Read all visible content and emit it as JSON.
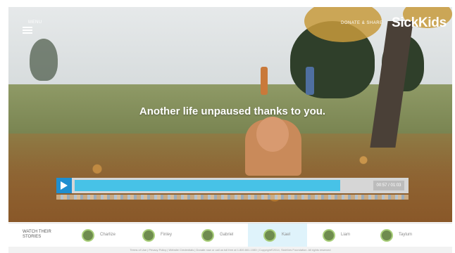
{
  "header": {
    "menu_label": "MENU",
    "donate_label": "DONATE & SHARE",
    "brand": "SickKids"
  },
  "hero": {
    "headline": "Another life unpaused thanks to you."
  },
  "player": {
    "time": "00:57 / 01:03",
    "progress": 0.82
  },
  "stories": {
    "title": "WATCH THEIR STORIES",
    "items": [
      {
        "name": "Charlize"
      },
      {
        "name": "Finley"
      },
      {
        "name": "Gabriel"
      },
      {
        "name": "Kael"
      },
      {
        "name": "Liam"
      },
      {
        "name": "Taylum"
      }
    ],
    "active_index": 3
  },
  "footer": {
    "text": "Terms of Use  |  Privacy Policy  |  Website Credentials  |  Donate now or call us toll free at 1.800.661.1083  |  Copyright©2014, SickKids Foundation. All rights reserved"
  },
  "colors": {
    "play_button": "#1f8fd0",
    "progress": "#47c2e7",
    "active_story_bg": "#dff3fb"
  }
}
